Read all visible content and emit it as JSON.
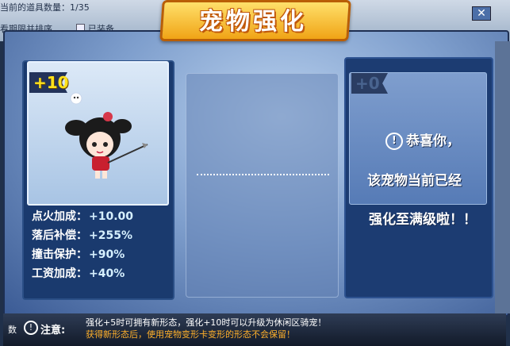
{
  "topbar": {
    "line1": "当前的道具数量：1/35",
    "sort_label": "看期限并排序",
    "equipped_label": "已装备"
  },
  "title": "宠物强化",
  "close_label": "✕",
  "left_card": {
    "level": "+10",
    "stats": [
      {
        "label": "点火加成：",
        "value": "+10.00"
      },
      {
        "label": "落后补偿：",
        "value": "+255%"
      },
      {
        "label": "撞击保护：",
        "value": "+90%"
      },
      {
        "label": "工资加成：",
        "value": "+40%"
      }
    ]
  },
  "right_card": {
    "level": "+0",
    "line1": "恭喜你，",
    "line2": "该宠物当前已经",
    "line3": "强化至满级啦！！"
  },
  "bottom": {
    "left_text": "数",
    "note_label": "注意:",
    "note_line1": "强化+5时可拥有新形态，强化+10时可以升级为休闲区骑宠！",
    "note_line2": "获得新形态后，使用宠物变形卡变形的形态不会保留！"
  }
}
